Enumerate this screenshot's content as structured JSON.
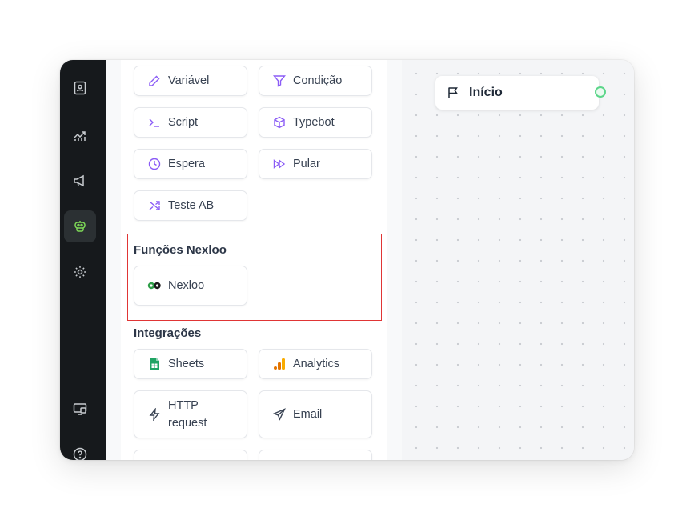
{
  "sidebar": {
    "icons": [
      "contacts-icon",
      "analytics-chart-icon",
      "megaphone-icon",
      "bot-icon",
      "settings-gear-icon",
      "dashboard-screen-icon",
      "help-icon"
    ],
    "active": "bot-icon"
  },
  "blocks": {
    "logic": [
      {
        "label": "Variável",
        "icon": "pencil-icon"
      },
      {
        "label": "Condição",
        "icon": "filter-icon"
      },
      {
        "label": "Script",
        "icon": "terminal-icon"
      },
      {
        "label": "Typebot",
        "icon": "cube-icon"
      },
      {
        "label": "Espera",
        "icon": "clock-icon"
      },
      {
        "label": "Pular",
        "icon": "fast-forward-icon"
      },
      {
        "label": "Teste AB",
        "icon": "shuffle-icon"
      }
    ],
    "nexloo_section_title": "Funções Nexloo",
    "nexloo": [
      {
        "label": "Nexloo",
        "icon": "nexloo-logo-icon"
      }
    ],
    "integrations_section_title": "Integrações",
    "integrations": [
      {
        "label": "Sheets",
        "icon": "sheets-icon"
      },
      {
        "label": "Analytics",
        "icon": "analytics-icon"
      },
      {
        "label": "HTTP request",
        "line1": "HTTP",
        "line2": "request",
        "icon": "lightning-icon"
      },
      {
        "label": "Email",
        "icon": "send-icon"
      }
    ]
  },
  "canvas": {
    "start_node_label": "Início"
  },
  "colors": {
    "accent_purple": "#8b5cf6",
    "highlight_red": "#e03535",
    "connector_green": "#5cd68a",
    "rail_dark": "#16191c",
    "active_green": "#7ed957"
  }
}
